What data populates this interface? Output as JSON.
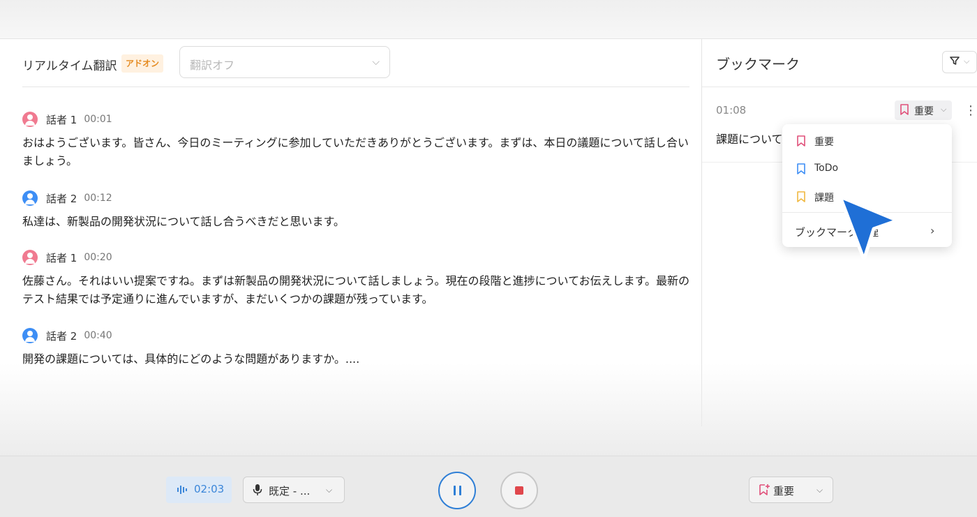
{
  "translation": {
    "label": "リアルタイム翻訳",
    "badge": "アドオン",
    "select_value": "翻訳オフ"
  },
  "transcript": [
    {
      "speaker": "話者 1",
      "time": "00:01",
      "text": "おはようございます。皆さん、今日のミーティングに参加していただきありがとうございます。まずは、本日の議題について話し合いましょう。",
      "avatar_color": "#f07a90"
    },
    {
      "speaker": "話者 2",
      "time": "00:12",
      "text": "私達は、新製品の開発状況について話し合うべきだと思います。",
      "avatar_color": "#3d8ef5"
    },
    {
      "speaker": "話者 1",
      "time": "00:20",
      "text": "佐藤さん。それはいい提案ですね。まずは新製品の開発状況について話しましょう。現在の段階と進捗についてお伝えします。最新のテスト結果では予定通りに進んでいますが、まだいくつかの課題が残っています。",
      "avatar_color": "#f07a90"
    },
    {
      "speaker": "話者 2",
      "time": "00:40",
      "text": "開発の課題については、具体的にどのような問題がありますか。....",
      "avatar_color": "#3d8ef5"
    }
  ],
  "bookmarks": {
    "title": "ブックマーク",
    "entry": {
      "time": "01:08",
      "tag": "重要",
      "text": "課題について"
    },
    "menu": {
      "items": [
        {
          "label": "重要",
          "color": "#e0507a"
        },
        {
          "label": "ToDo",
          "color": "#3d8ef5"
        },
        {
          "label": "課題",
          "color": "#f0b840"
        }
      ],
      "manage": "ブックマーク管理"
    }
  },
  "bottom": {
    "timer": "02:03",
    "mic": "既定 - ...",
    "bookmark_button": "重要"
  },
  "colors": {
    "accent": "#2f7fd6",
    "stop": "#e0474c",
    "cursor": "#1f6fd6"
  }
}
